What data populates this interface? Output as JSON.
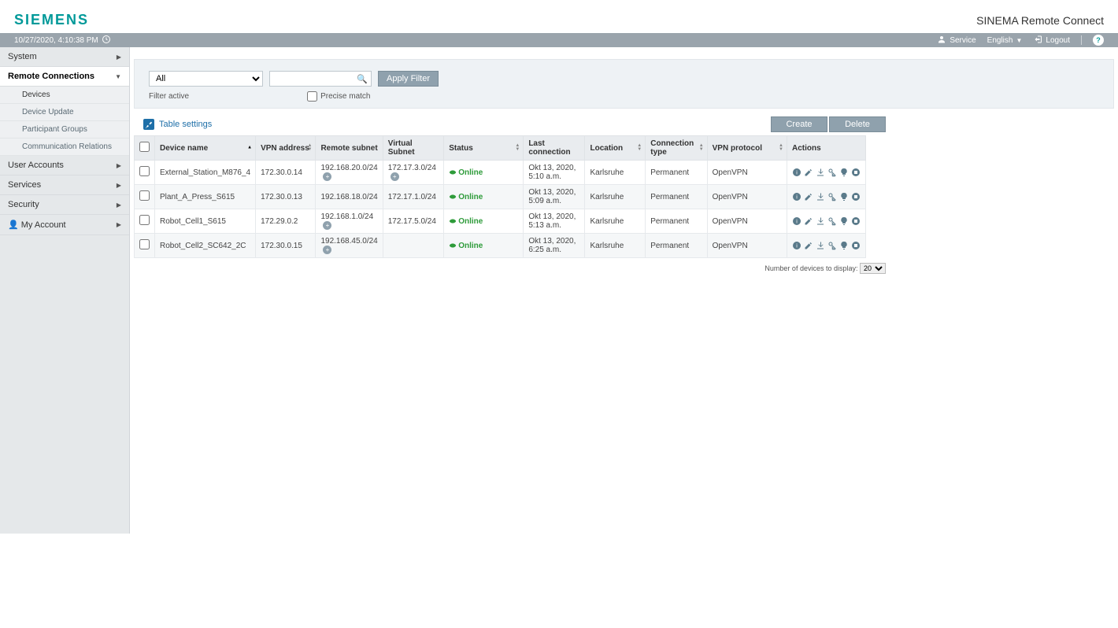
{
  "header": {
    "logo": "SIEMENS",
    "product": "SINEMA Remote Connect"
  },
  "topbar": {
    "timestamp": "10/27/2020, 4:10:38 PM",
    "service": "Service",
    "language": "English",
    "logout": "Logout"
  },
  "sidebar": {
    "items": [
      {
        "label": "System",
        "expanded": false
      },
      {
        "label": "Remote Connections",
        "expanded": true,
        "subs": [
          {
            "label": "Devices",
            "active": true
          },
          {
            "label": "Device Update"
          },
          {
            "label": "Participant Groups"
          },
          {
            "label": "Communication Relations"
          }
        ]
      },
      {
        "label": "User Accounts",
        "expanded": false
      },
      {
        "label": "Services",
        "expanded": false
      },
      {
        "label": "Security",
        "expanded": false
      },
      {
        "label": "My Account",
        "expanded": false,
        "icon": "user"
      }
    ]
  },
  "filter": {
    "dropdown": "All",
    "search": "",
    "apply": "Apply Filter",
    "active_label": "Filter active",
    "precise_label": "Precise match"
  },
  "table": {
    "settings_label": "Table settings",
    "create": "Create",
    "delete": "Delete",
    "columns": {
      "device_name": "Device name",
      "vpn_address": "VPN address",
      "remote_subnet": "Remote subnet",
      "virtual_subnet": "Virtual Subnet",
      "status": "Status",
      "last_connection": "Last connection",
      "location": "Location",
      "connection_type": "Connection type",
      "vpn_protocol": "VPN protocol",
      "actions": "Actions"
    },
    "status_online": "Online",
    "rows": [
      {
        "name": "External_Station_M876_4",
        "vpn": "172.30.0.14",
        "remote": "192.168.20.0/24",
        "remote_plus": true,
        "virtual": "172.17.3.0/24",
        "virtual_plus": true,
        "last": "Okt 13, 2020, 5:10 a.m.",
        "loc": "Karlsruhe",
        "ctype": "Permanent",
        "proto": "OpenVPN"
      },
      {
        "name": "Plant_A_Press_S615",
        "vpn": "172.30.0.13",
        "remote": "192.168.18.0/24",
        "remote_plus": false,
        "virtual": "172.17.1.0/24",
        "virtual_plus": false,
        "last": "Okt 13, 2020, 5:09 a.m.",
        "loc": "Karlsruhe",
        "ctype": "Permanent",
        "proto": "OpenVPN"
      },
      {
        "name": "Robot_Cell1_S615",
        "vpn": "172.29.0.2",
        "remote": "192.168.1.0/24",
        "remote_plus": true,
        "virtual": "172.17.5.0/24",
        "virtual_plus": false,
        "last": "Okt 13, 2020, 5:13 a.m.",
        "loc": "Karlsruhe",
        "ctype": "Permanent",
        "proto": "OpenVPN"
      },
      {
        "name": "Robot_Cell2_SC642_2C",
        "vpn": "172.30.0.15",
        "remote": "192.168.45.0/24",
        "remote_plus": true,
        "virtual": "",
        "virtual_plus": false,
        "last": "Okt 13, 2020, 6:25 a.m.",
        "loc": "Karlsruhe",
        "ctype": "Permanent",
        "proto": "OpenVPN"
      }
    ],
    "pager_label": "Number of devices to display:",
    "pager_value": "20"
  }
}
